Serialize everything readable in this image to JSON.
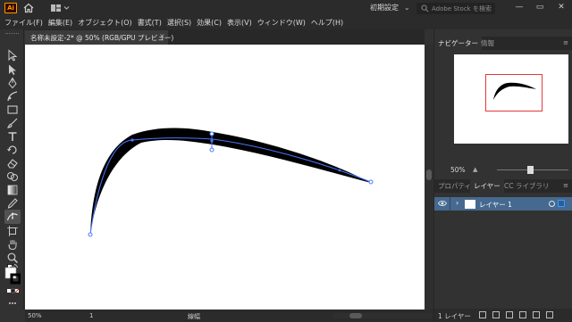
{
  "app": {
    "logo": "Ai"
  },
  "titlebar": {
    "workspace": "初期設定",
    "stock_search_placeholder": "Adobe Stock を検索",
    "window_buttons": [
      "minimize-icon",
      "maximize-icon",
      "close-icon"
    ]
  },
  "menu": {
    "items": [
      "ファイル(F)",
      "編集(E)",
      "オブジェクト(O)",
      "書式(T)",
      "選択(S)",
      "効果(C)",
      "表示(V)",
      "ウィンドウ(W)",
      "ヘルプ(H)"
    ]
  },
  "document": {
    "tab_title": "名称未設定-2* @ 50% (RGB/GPU プレビュー)",
    "close_glyph": "×"
  },
  "navigator": {
    "tabs": [
      "ナビゲーター",
      "情報"
    ],
    "zoom": "50%",
    "menu_glyph": "≡"
  },
  "layers_panel": {
    "tabs": [
      "プロパティ",
      "レイヤー",
      "CC ライブラリ"
    ],
    "layers": [
      {
        "name": "レイヤー 1",
        "expand_glyph": "›"
      }
    ],
    "footer_count": "1 レイヤー",
    "menu_glyph": "≡"
  },
  "statusbar": {
    "zoom": "50%",
    "page": "1",
    "mode": "線幅"
  },
  "colors": {
    "accent_layer_selection": "#46698f",
    "ai_logo_orange": "#ff9a00",
    "navigator_viewbox": "#e23a3a",
    "path_anchor_blue": "#4b78ff"
  }
}
